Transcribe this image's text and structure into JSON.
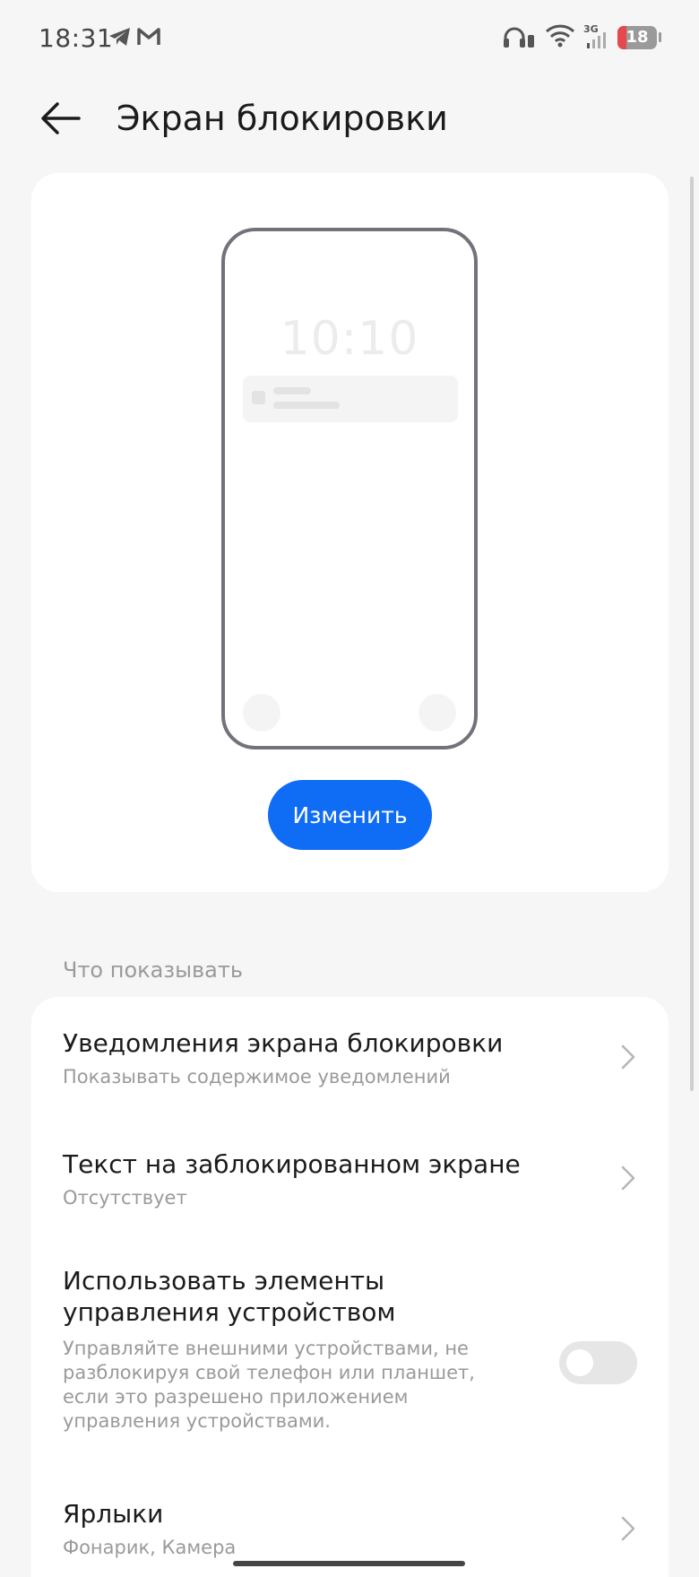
{
  "status_bar": {
    "time": "18:31",
    "network": "3G",
    "battery": "18",
    "icons": [
      "telegram-icon",
      "gmail-icon",
      "headphones-icon",
      "wifi-icon",
      "signal-icon",
      "battery-icon"
    ]
  },
  "header": {
    "title": "Экран блокировки"
  },
  "preview": {
    "clock": "10:10",
    "change_button": "Изменить"
  },
  "section": {
    "label": "Что показывать"
  },
  "settings": [
    {
      "title": "Уведомления экрана блокировки",
      "subtitle": "Показывать содержимое уведомлений"
    },
    {
      "title": "Текст на заблокированном экране",
      "subtitle": "Отсутствует"
    },
    {
      "title_line1": "Использовать элементы",
      "title_line2": "управления устройством",
      "sub_line1": "Управляйте внешними устройствами, не",
      "sub_line2": "разблокируя свой телефон или планшет,",
      "sub_line3": "если это разрешено приложением",
      "sub_line4": "управления устройствами.",
      "toggle_on": false
    },
    {
      "title": "Ярлыки",
      "subtitle": "Фонарик, Камера"
    }
  ],
  "colors": {
    "accent": "#0f6cf5",
    "background": "#f6f6f6",
    "battery_low": "#e5484d"
  }
}
